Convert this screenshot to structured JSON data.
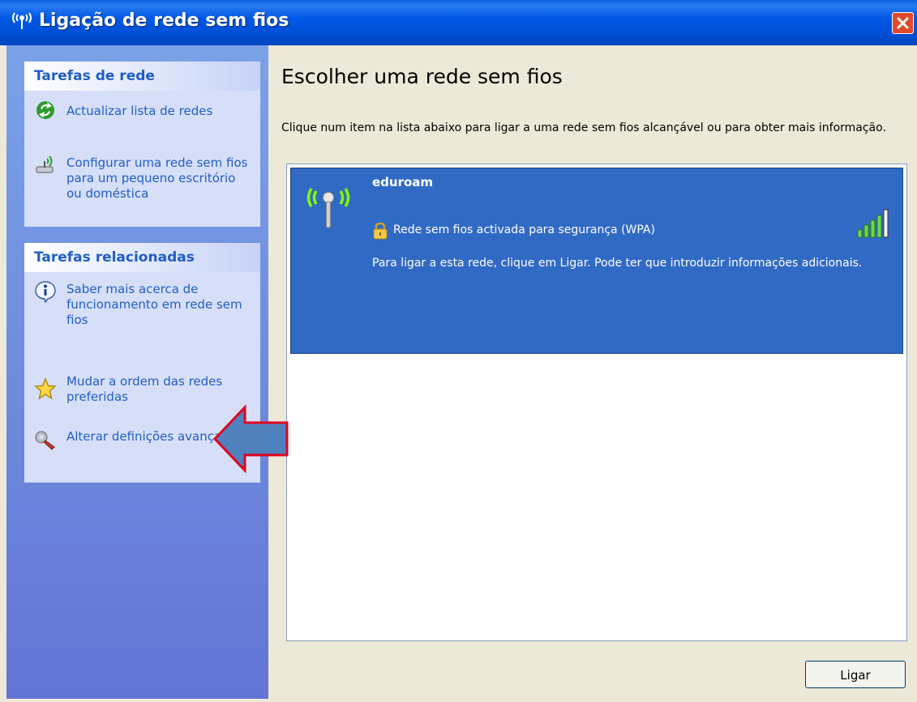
{
  "window": {
    "title": "Ligação de rede sem fios"
  },
  "sidebar": {
    "network_tasks": {
      "header": "Tarefas de rede",
      "items": [
        {
          "label": "Actualizar lista de redes",
          "icon": "refresh-icon"
        },
        {
          "label": "Configurar uma rede sem fios para um pequeno escritório ou doméstica",
          "icon": "wireless-setup-icon"
        }
      ]
    },
    "related_tasks": {
      "header": "Tarefas relacionadas",
      "items": [
        {
          "label": "Saber mais acerca de funcionamento em rede sem fios",
          "icon": "info-icon"
        },
        {
          "label": "Mudar a ordem das redes preferidas",
          "icon": "star-icon"
        },
        {
          "label": "Alterar definições avançadas",
          "icon": "wrench-icon"
        }
      ]
    }
  },
  "main": {
    "heading": "Escolher uma rede sem fios",
    "instruction": "Clique num item na lista abaixo para ligar a uma rede sem fios alcançável ou para obter mais informação.",
    "networks": [
      {
        "name": "eduroam",
        "security": "Rede sem fios activada para segurança (WPA)",
        "description": "Para ligar a esta rede, clique em Ligar. Pode ter que introduzir informações adicionais.",
        "signal_bars": 5,
        "selected": true
      }
    ],
    "connect_label": "Ligar"
  },
  "colors": {
    "titlebar": "#0058E6",
    "sidebar_bg": "#7BA2E7",
    "task_link": "#215DC6",
    "selection": "#316AC5",
    "annotation_arrow": "#4F81BD",
    "annotation_arrow_border": "#E3001B"
  }
}
